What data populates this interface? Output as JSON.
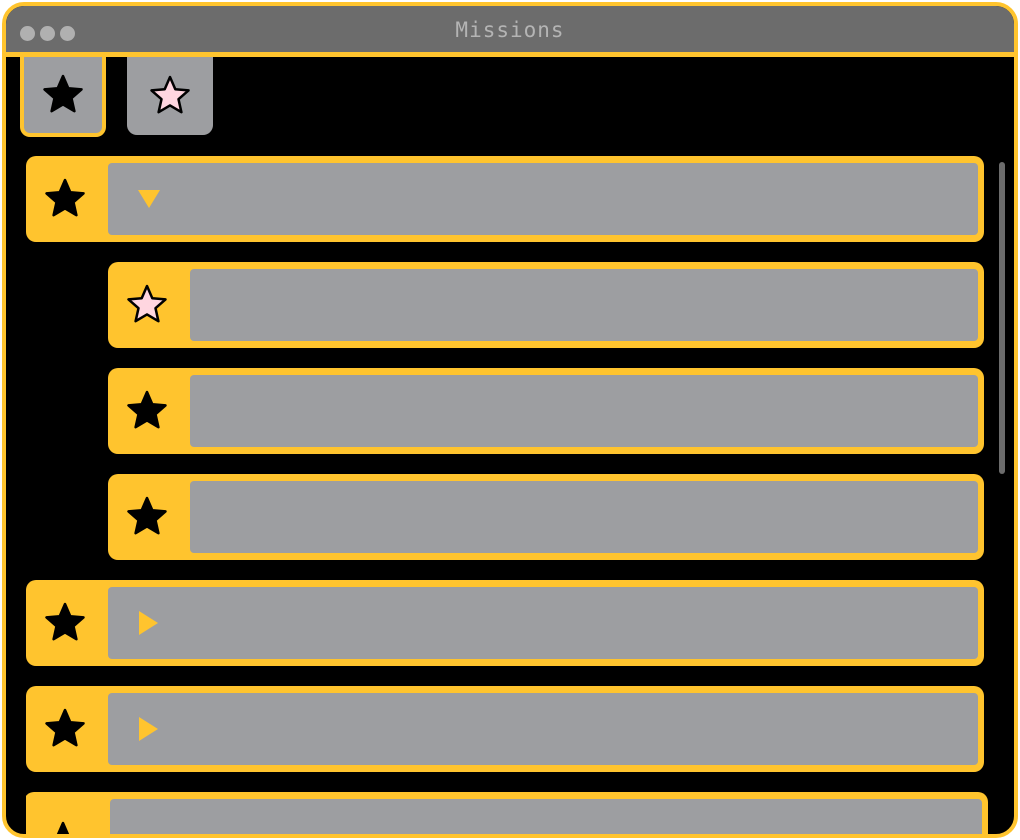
{
  "window": {
    "title": "Missions"
  },
  "tabs": [
    {
      "icon": "star-filled-icon",
      "selected": true
    },
    {
      "icon": "star-outline-pink-icon",
      "selected": false
    }
  ],
  "missions": [
    {
      "icon": "star-filled-icon",
      "expanded": true,
      "level": 0,
      "label": ""
    },
    {
      "icon": "star-outline-pink-icon",
      "level": 1,
      "label": ""
    },
    {
      "icon": "star-filled-icon",
      "level": 1,
      "label": ""
    },
    {
      "icon": "star-filled-icon",
      "level": 1,
      "label": ""
    },
    {
      "icon": "star-filled-icon",
      "expanded": false,
      "level": 0,
      "label": ""
    },
    {
      "icon": "star-filled-icon",
      "expanded": false,
      "level": 0,
      "label": ""
    },
    {
      "icon": "star-filled-icon",
      "expanded": true,
      "level": 0,
      "label": ""
    }
  ],
  "colors": {
    "accent": "#FFC42E",
    "row_body": "#9d9ea1",
    "titlebar": "#6c6c6c",
    "background": "#000000",
    "pink_star": "#FFD6E0"
  }
}
